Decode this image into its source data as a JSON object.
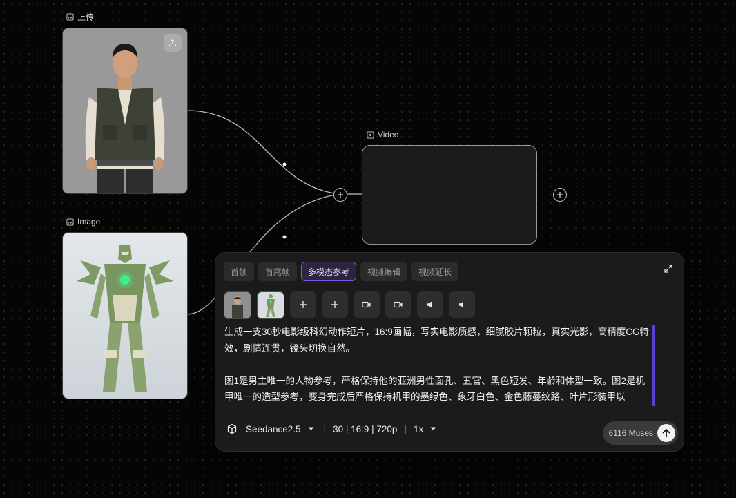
{
  "nodes": {
    "upload": {
      "label": "上传"
    },
    "image": {
      "label": "Image"
    },
    "video": {
      "label": "Video"
    }
  },
  "panel": {
    "tabs": [
      {
        "label": "首帧",
        "active": false
      },
      {
        "label": "首尾帧",
        "active": false
      },
      {
        "label": "多模态参考",
        "active": true
      },
      {
        "label": "视频编辑",
        "active": false
      },
      {
        "label": "视频延长",
        "active": false
      }
    ],
    "reference_buttons": [
      "person-thumbnail",
      "mech-thumbnail",
      "plus-icon",
      "plus-icon",
      "video-camera-icon",
      "video-camera-icon",
      "speaker-icon",
      "speaker-icon"
    ],
    "prompt_text": "生成一支30秒电影级科幻动作短片，16:9画幅，写实电影质感，细腻胶片颗粒，真实光影，高精度CG特效，剧情连贯，镜头切换自然。\n\n图1是男主唯一的人物参考，严格保持他的亚洲男性面孔、五官、黑色短发、年龄和体型一致。图2是机甲唯一的造型参考，变身完成后严格保持机甲的墨绿色、象牙白色、金色藤蔓纹路、叶片形装甲以",
    "model": "Seedance2.5",
    "settings": "30 | 16:9 | 720p",
    "multiplier": "1x",
    "cost": "6116 Muses"
  },
  "colors": {
    "accent": "#7b5cd6",
    "background": "#050505",
    "panel": "#1b1b1b"
  }
}
